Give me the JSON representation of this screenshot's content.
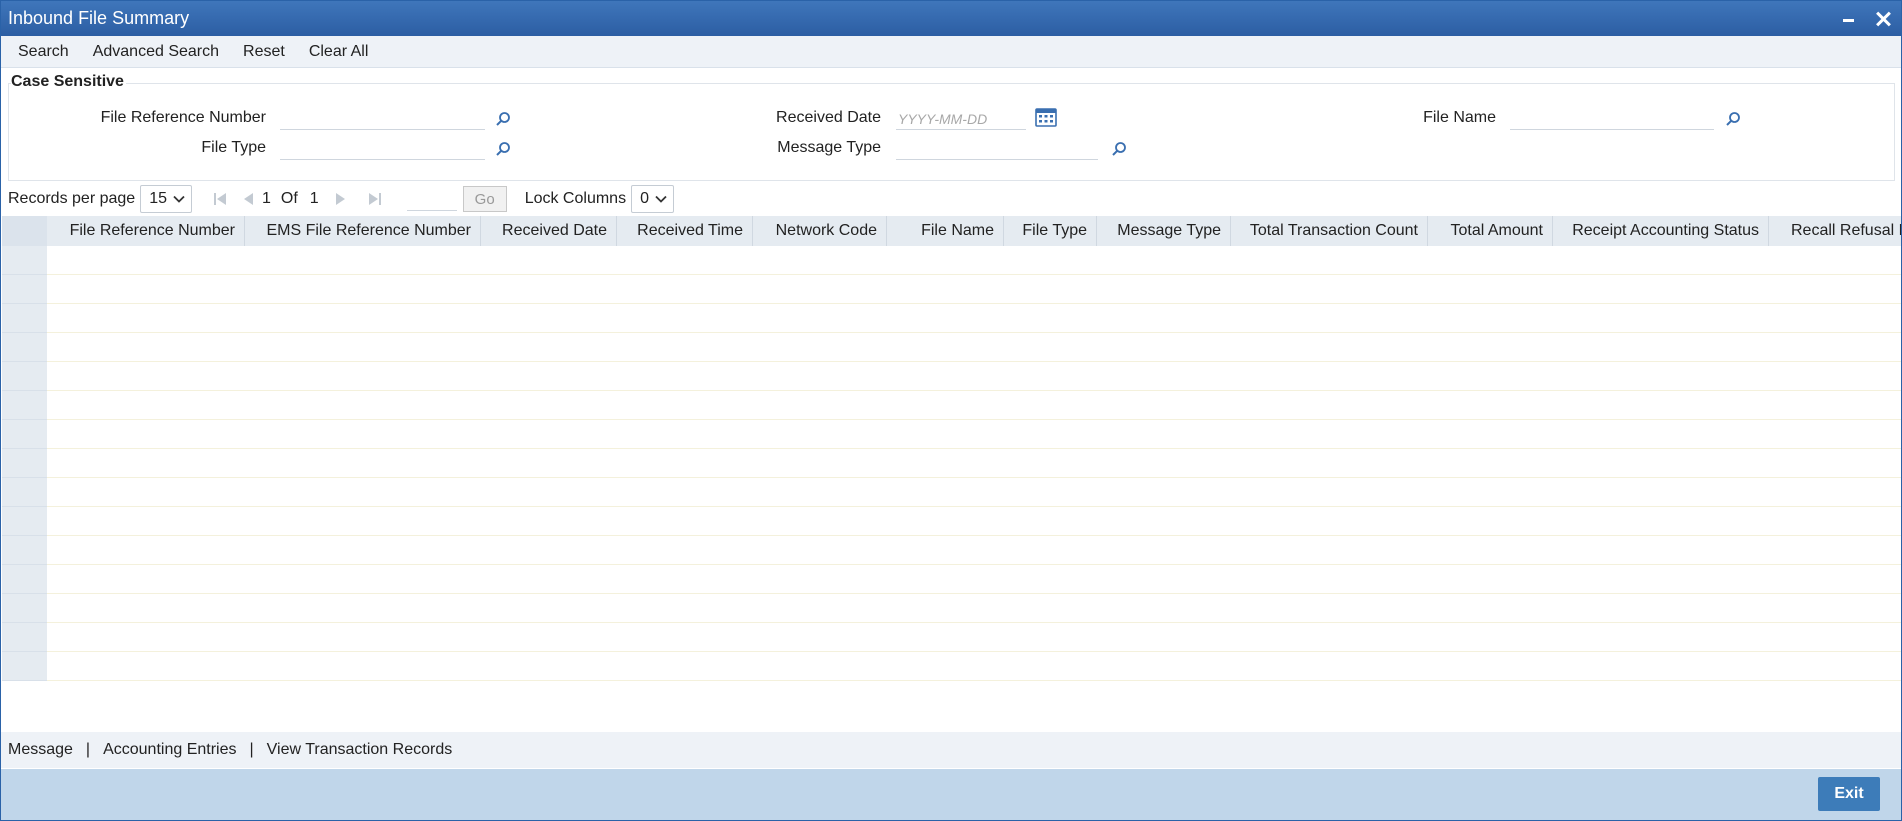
{
  "window": {
    "title": "Inbound File Summary"
  },
  "toolbar": {
    "search": "Search",
    "advanced_search": "Advanced Search",
    "reset": "Reset",
    "clear_all": "Clear All"
  },
  "criteria": {
    "section_label": "Case Sensitive",
    "file_reference_number": {
      "label": "File Reference Number",
      "value": ""
    },
    "file_type": {
      "label": "File Type",
      "value": ""
    },
    "received_date": {
      "label": "Received Date",
      "value": "",
      "placeholder": "YYYY-MM-DD"
    },
    "message_type": {
      "label": "Message Type",
      "value": ""
    },
    "file_name": {
      "label": "File Name",
      "value": ""
    }
  },
  "pager": {
    "records_label": "Records per page",
    "records_value": "15",
    "current_page": "1",
    "of_label": "Of",
    "total_pages": "1",
    "go_label": "Go",
    "lock_label": "Lock Columns",
    "lock_value": "0"
  },
  "grid": {
    "columns": [
      "File Reference Number",
      "EMS File Reference Number",
      "Received Date",
      "Received Time",
      "Network Code",
      "File Name",
      "File Type",
      "Message Type",
      "Total Transaction Count",
      "Total Amount",
      "Receipt Accounting Status",
      "Recall Refusal B"
    ],
    "rows": []
  },
  "bottom_links": {
    "message": "Message",
    "accounting_entries": "Accounting Entries",
    "view_transaction_records": "View Transaction Records",
    "separator": "|"
  },
  "footer": {
    "exit": "Exit"
  },
  "colors": {
    "title_bar": "#2c5ea3",
    "footer": "#c0d6ea",
    "exit_button": "#3d7cb9",
    "grid_header": "#e5ebf1"
  }
}
